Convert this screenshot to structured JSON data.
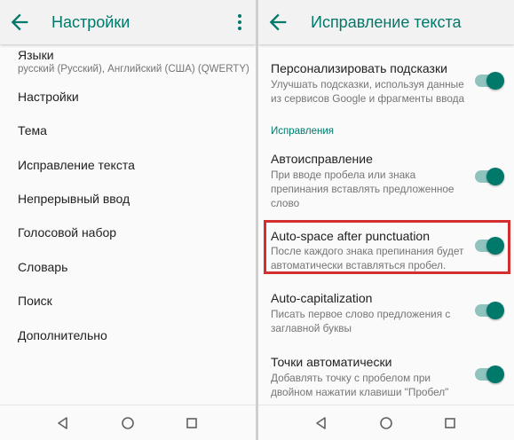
{
  "left": {
    "title": "Настройки",
    "languages": {
      "title": "Языки",
      "subtitle": "русский (Русский), Английский (США) (QWERTY)"
    },
    "items": [
      "Настройки",
      "Тема",
      "Исправление текста",
      "Непрерывный ввод",
      "Голосовой набор",
      "Словарь",
      "Поиск",
      "Дополнительно"
    ]
  },
  "right": {
    "title": "Исправление текста",
    "section_label": "Исправления",
    "prefs": [
      {
        "title": "Персонализировать подсказки",
        "summary": "Улучшать подсказки, используя данные из сервисов Google и фрагменты ввода",
        "enabled": true
      },
      {
        "title": "Автоисправление",
        "summary": "При вводе пробела или знака препинания вставлять предложенное слово",
        "enabled": true
      },
      {
        "title": "Auto-space after punctuation",
        "summary": "После каждого знака препинания будет автоматически вставляться пробел.",
        "enabled": true
      },
      {
        "title": "Auto-capitalization",
        "summary": "Писать первое слово предложения с заглавной буквы",
        "enabled": true
      },
      {
        "title": "Точки автоматически",
        "summary": "Добавлять точку с пробелом при двойном нажатии клавиши \"Пробел\"",
        "enabled": true
      }
    ]
  },
  "icons": {
    "back": "arrow-left-icon",
    "overflow": "more-vert-icon",
    "nav_back": "triangle-back-icon",
    "nav_home": "circle-home-icon",
    "nav_recents": "square-recents-icon"
  },
  "colors": {
    "accent": "#00796b",
    "switch_track": "#8fc3bd",
    "highlight": "#d32f2f"
  }
}
